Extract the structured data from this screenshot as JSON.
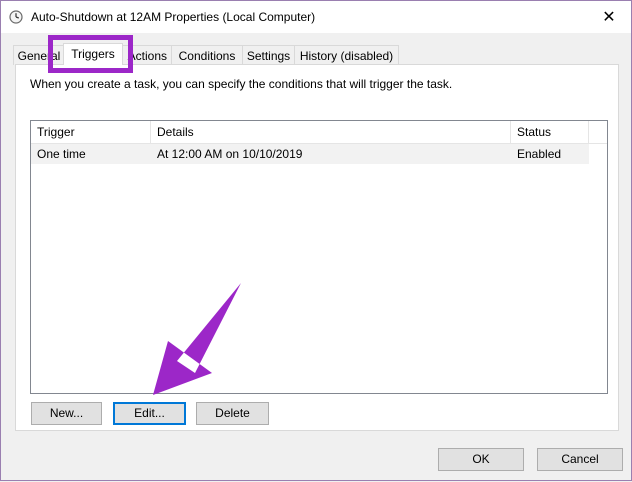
{
  "window": {
    "title": "Auto-Shutdown at 12AM Properties (Local Computer)",
    "close_label": "✕"
  },
  "tabs": [
    {
      "label": "General"
    },
    {
      "label": "Triggers",
      "active": true
    },
    {
      "label": "Actions"
    },
    {
      "label": "Conditions"
    },
    {
      "label": "Settings"
    },
    {
      "label": "History (disabled)"
    }
  ],
  "intro_text": "When you create a task, you can specify the conditions that will trigger the task.",
  "trigger_list": {
    "columns": [
      "Trigger",
      "Details",
      "Status"
    ],
    "rows": [
      {
        "trigger": "One time",
        "details": "At 12:00 AM on 10/10/2019",
        "status": "Enabled"
      }
    ]
  },
  "buttons": {
    "new": "New...",
    "edit": "Edit...",
    "delete": "Delete",
    "ok": "OK",
    "cancel": "Cancel"
  },
  "annotation_color": "#9c27c8"
}
